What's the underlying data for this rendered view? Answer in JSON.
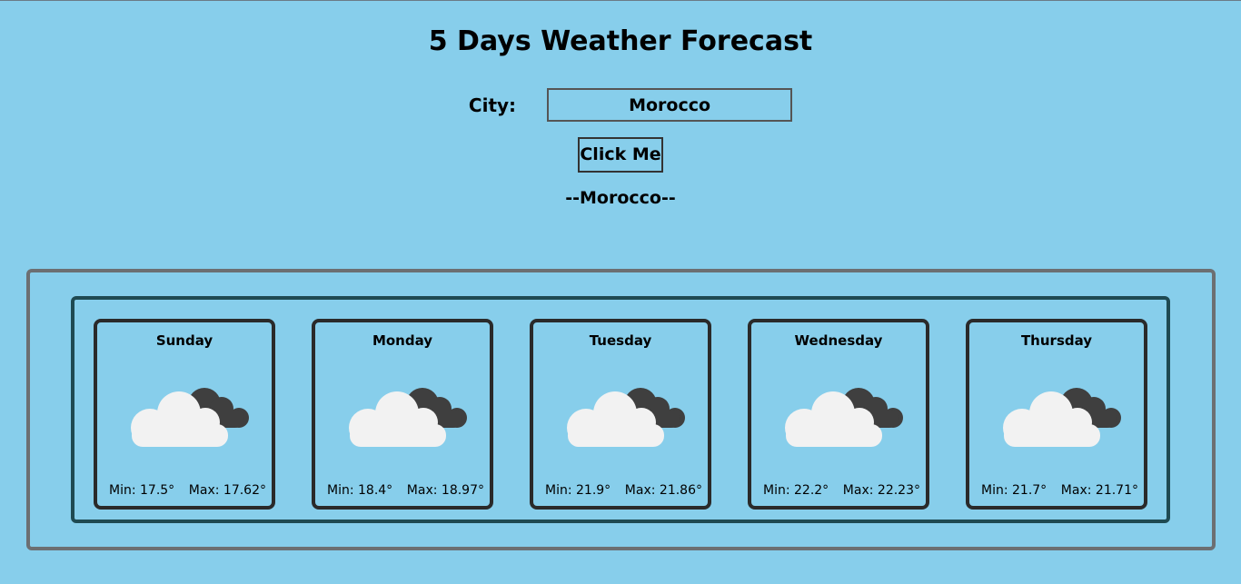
{
  "header": {
    "title": "5 Days Weather Forecast"
  },
  "search": {
    "label": "City:",
    "value": "Morocco",
    "button_label": "Click Me"
  },
  "result": {
    "city_heading": "--Morocco--"
  },
  "forecast": [
    {
      "day": "Sunday",
      "min": "Min: 17.5°",
      "max": "Max: 17.62°",
      "icon": "partly-cloudy-icon"
    },
    {
      "day": "Monday",
      "min": "Min: 18.4°",
      "max": "Max: 18.97°",
      "icon": "partly-cloudy-icon"
    },
    {
      "day": "Tuesday",
      "min": "Min: 21.9°",
      "max": "Max: 21.86°",
      "icon": "partly-cloudy-icon"
    },
    {
      "day": "Wednesday",
      "min": "Min: 22.2°",
      "max": "Max: 22.23°",
      "icon": "partly-cloudy-icon"
    },
    {
      "day": "Thursday",
      "min": "Min: 21.7°",
      "max": "Max: 21.71°",
      "icon": "partly-cloudy-icon"
    }
  ],
  "colors": {
    "background": "#87ceeb",
    "outer_border": "#6c6f72",
    "inner_border": "#1f4a52",
    "card_border": "#2a2a2a",
    "cloud_light": "#f2f2f2",
    "cloud_dark": "#3f3f3f"
  }
}
